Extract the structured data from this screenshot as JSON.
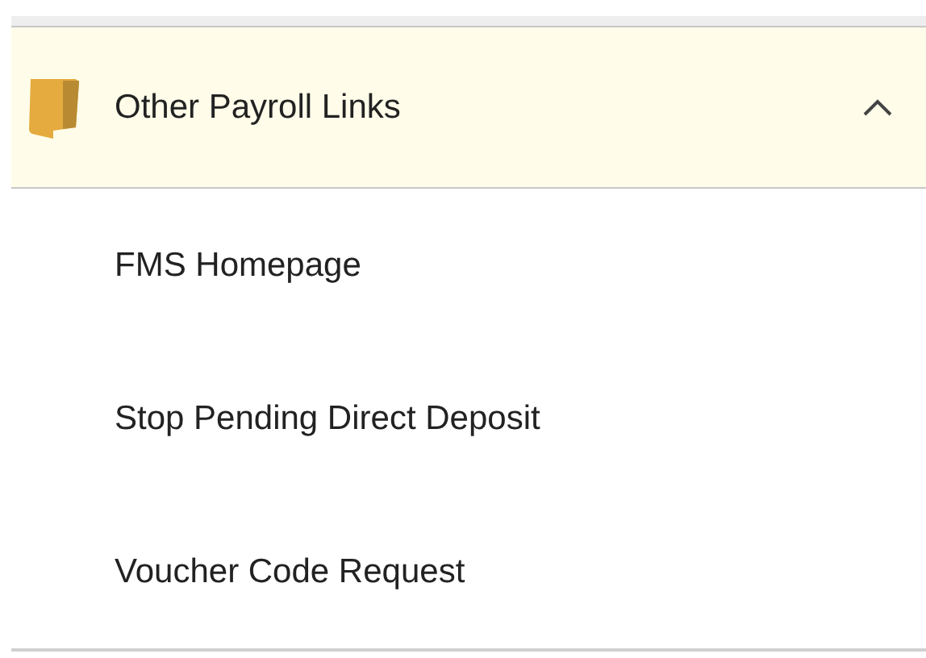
{
  "section": {
    "title": "Other Payroll Links",
    "expanded": true,
    "links": [
      {
        "label": "FMS Homepage"
      },
      {
        "label": "Stop Pending Direct Deposit"
      },
      {
        "label": "Voucher Code Request"
      }
    ]
  }
}
